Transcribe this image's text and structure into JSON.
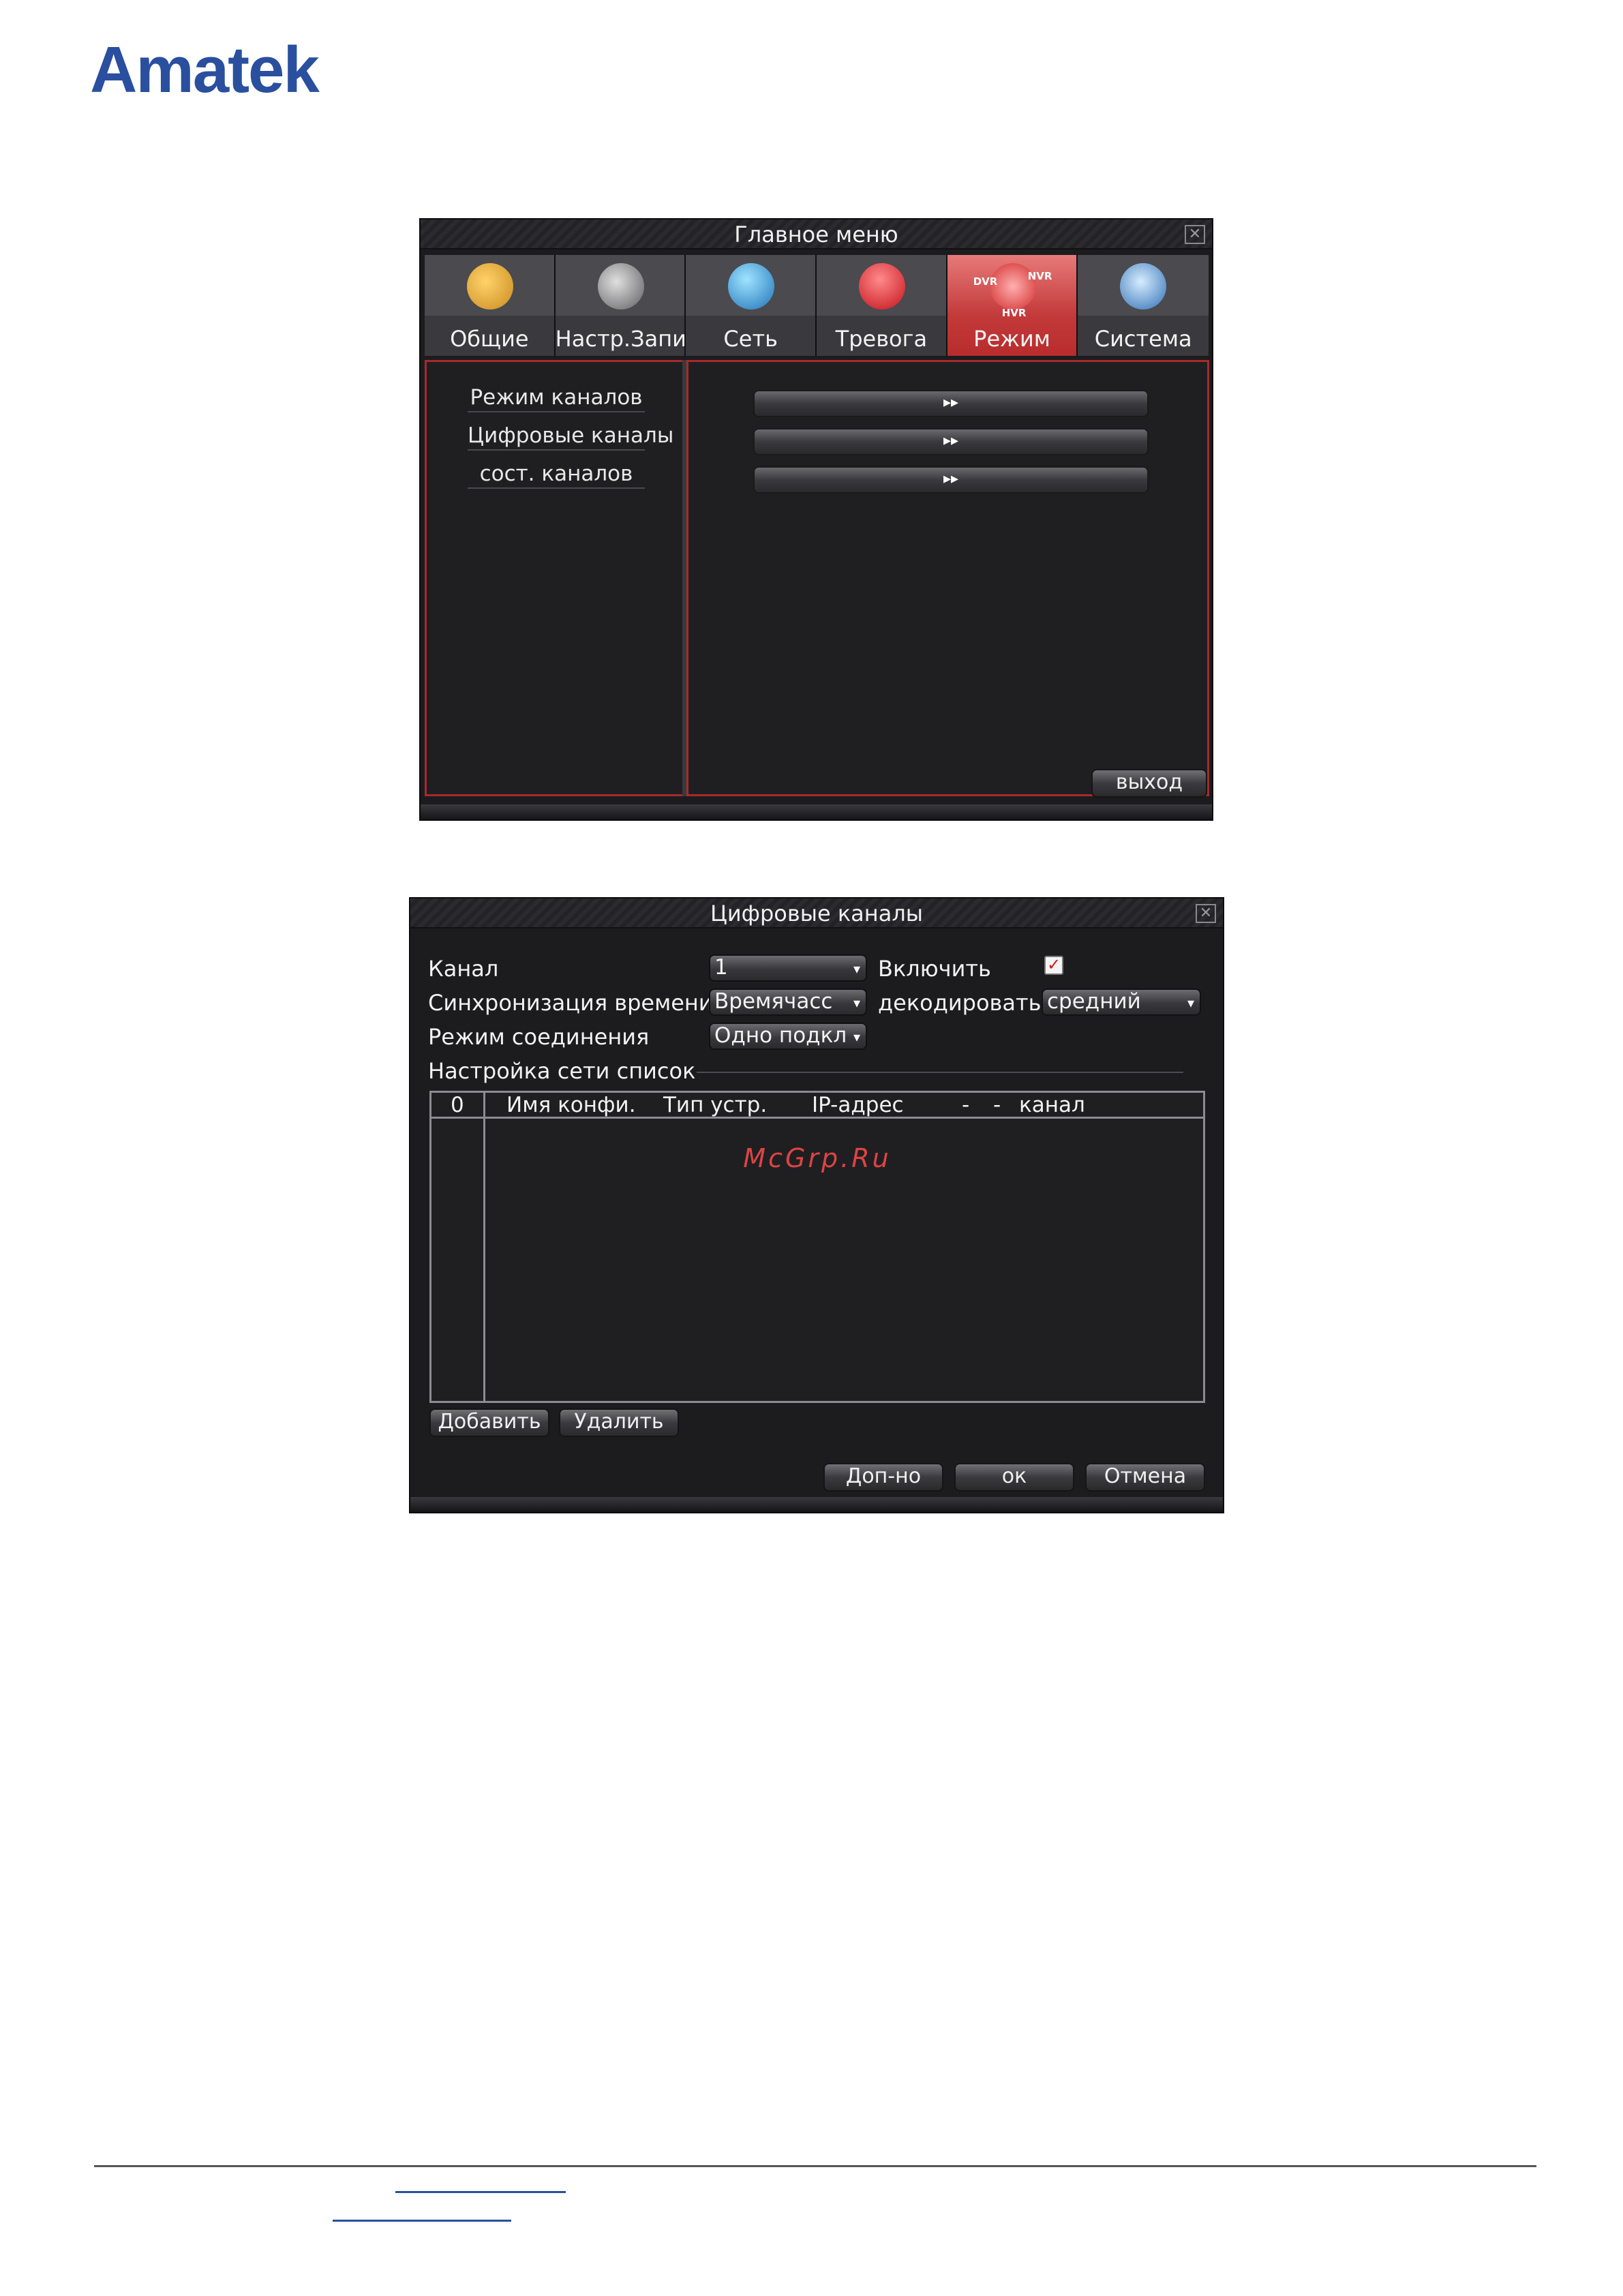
{
  "brand": {
    "logo": "Amatek"
  },
  "main_menu": {
    "title": "Главное меню",
    "close": "✕",
    "tabs": [
      {
        "label": "Общие",
        "icon": "general-icon"
      },
      {
        "label": "Настр.Запис",
        "icon": "record-icon"
      },
      {
        "label": "Сеть",
        "icon": "network-icon"
      },
      {
        "label": "Тревога",
        "icon": "alarm-icon"
      },
      {
        "label": "Режим",
        "icon": "mode-icon",
        "active": true
      },
      {
        "label": "Система",
        "icon": "system-icon"
      }
    ],
    "mode_icon_tags": [
      "DVR",
      "NVR",
      "HVR"
    ],
    "items": [
      "Режим каналов",
      "Цифровые каналы",
      "сост. каналов"
    ],
    "item_button": "▸▸",
    "exit_button": "выход"
  },
  "digital_channels": {
    "title": "Цифровые каналы",
    "close": "✕",
    "channel_label": "Канал",
    "channel_value": "1",
    "enable_label": "Включить",
    "enable_checked": "✓",
    "time_sync_label": "Синхронизация времени",
    "time_sync_value": "Времячасс",
    "decode_label": "декодировать",
    "decode_value": "средний",
    "connection_mode_label": "Режим соединения",
    "connection_mode_value": "Одно подкл",
    "network_list_label": "Настройка сети список",
    "table_headers": [
      "0",
      "Имя конфи.",
      "Тип устр.",
      "IP-адрес",
      "-",
      "-",
      "канал"
    ],
    "watermark": "McGrp.Ru",
    "add_button": "Добавить",
    "delete_button": "Удалить",
    "advanced_button": "Доп-но",
    "ok_button": "ок",
    "cancel_button": "Отмена"
  }
}
